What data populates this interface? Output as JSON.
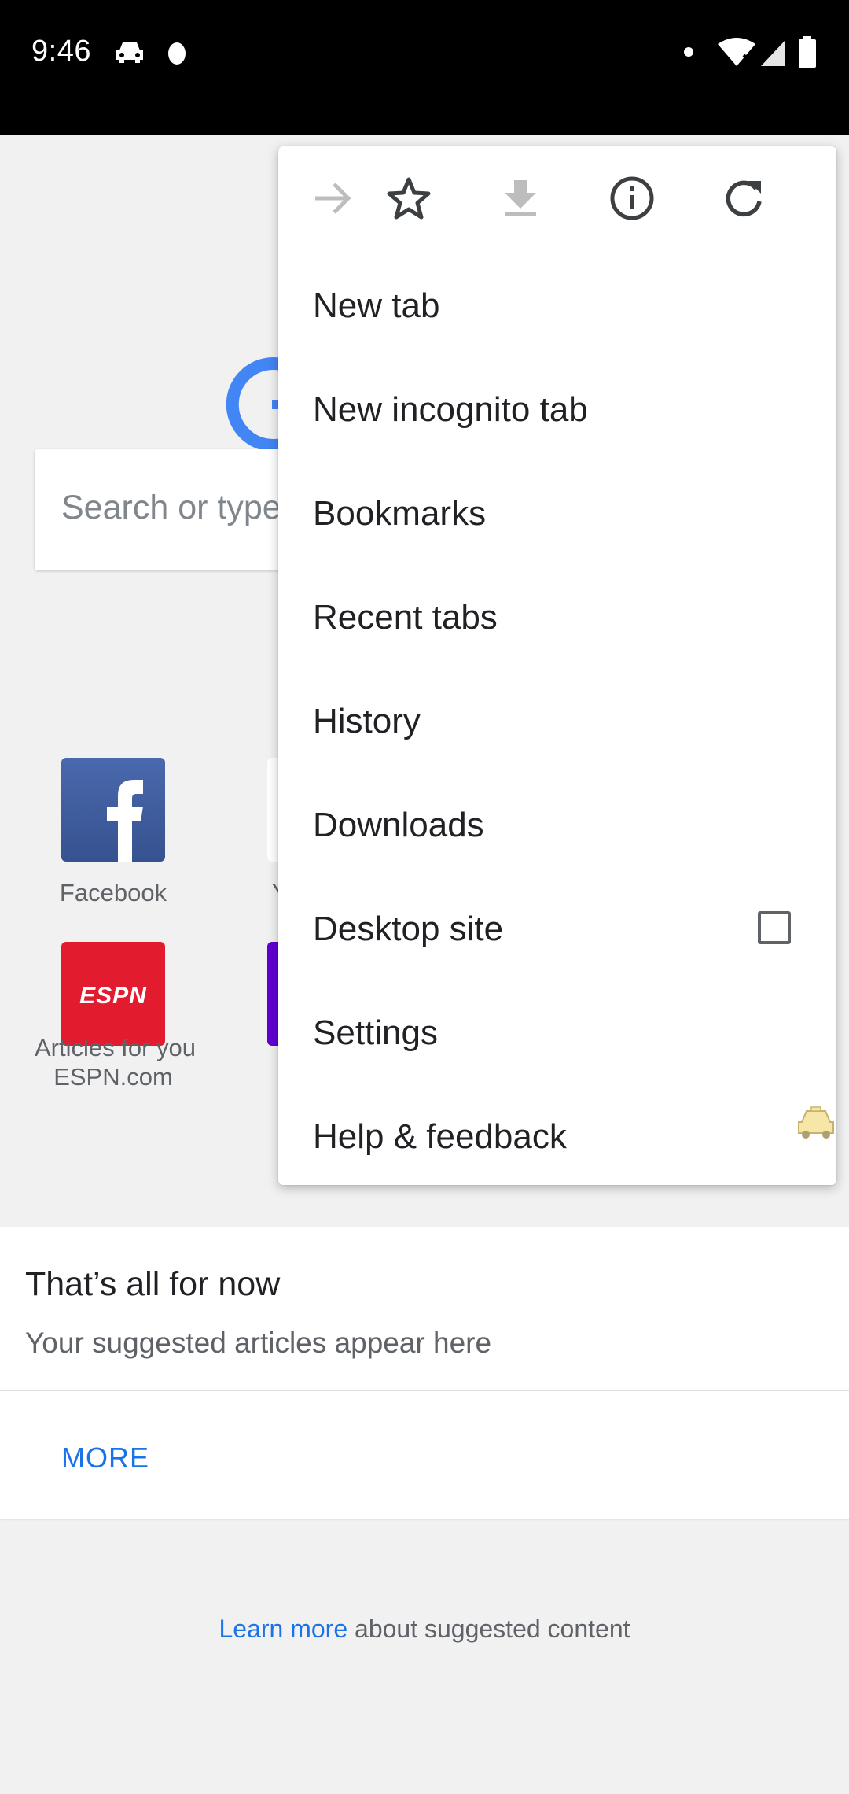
{
  "status_bar": {
    "time": "9:46",
    "left_icons": [
      "taxi-icon",
      "notification-dot-icon"
    ],
    "right_icons": [
      "dot-icon",
      "wifi-icon",
      "signal-icon",
      "battery-icon"
    ]
  },
  "ntp": {
    "search_placeholder": "Search or type",
    "tiles": [
      {
        "label": "Facebook",
        "icon": "facebook-icon"
      },
      {
        "label": "Y",
        "icon": "partial-tile-icon"
      },
      {
        "label": "ESPN.com",
        "icon": "espn-icon"
      },
      {
        "label": "",
        "icon": "partial-tile-icon"
      }
    ],
    "articles_header": "Articles for you",
    "feed": {
      "title": "That’s all for now",
      "subtitle": "Your suggested articles appear here",
      "more_label": "MORE"
    },
    "learn_more_link": "Learn more",
    "learn_more_rest": " about suggested content"
  },
  "menu": {
    "toolbar": [
      "forward-icon",
      "bookmark-star-icon",
      "download-icon",
      "info-icon",
      "refresh-icon"
    ],
    "items": [
      {
        "label": "New tab"
      },
      {
        "label": "New incognito tab"
      },
      {
        "label": "Bookmarks"
      },
      {
        "label": "Recent tabs"
      },
      {
        "label": "History"
      },
      {
        "label": "Downloads"
      },
      {
        "label": "Desktop site",
        "checkbox": false
      },
      {
        "label": "Settings"
      },
      {
        "label": "Help & feedback"
      }
    ]
  },
  "colors": {
    "status_bar": "#000000",
    "background": "#f1f1f1",
    "link_blue": "#1a73e8",
    "google_blue": "#4285f4",
    "espn_red": "#e31b2f",
    "facebook_blue": "#3b5998"
  }
}
